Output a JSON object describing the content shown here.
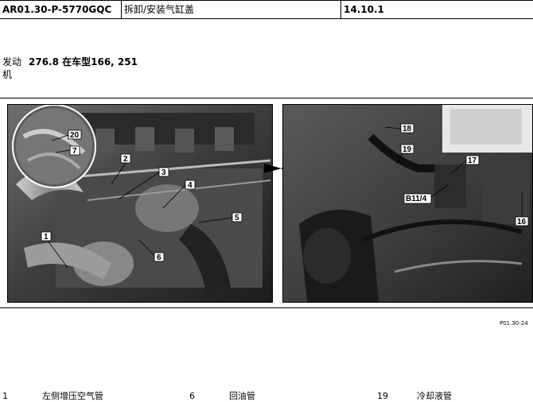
{
  "header": {
    "doc_id": "AR01.30-P-5770GQC",
    "title": "拆卸/安装气缸盖",
    "date": "14.10.1"
  },
  "engine": {
    "label_line1": "发动",
    "label_line2": "机",
    "value": "276.8 在车型166, 251"
  },
  "figure": {
    "ref": "P01.30-24",
    "left_callouts": [
      "20",
      "7",
      "2",
      "3",
      "4",
      "5",
      "1",
      "6"
    ],
    "right_callouts": [
      "18",
      "19",
      "17",
      "B11/4",
      "16"
    ]
  },
  "legend": [
    {
      "num": "1",
      "text": "左侧增压空气管"
    },
    {
      "num": "6",
      "text": "回油管"
    },
    {
      "num": "19",
      "text": "冷却液管"
    }
  ]
}
